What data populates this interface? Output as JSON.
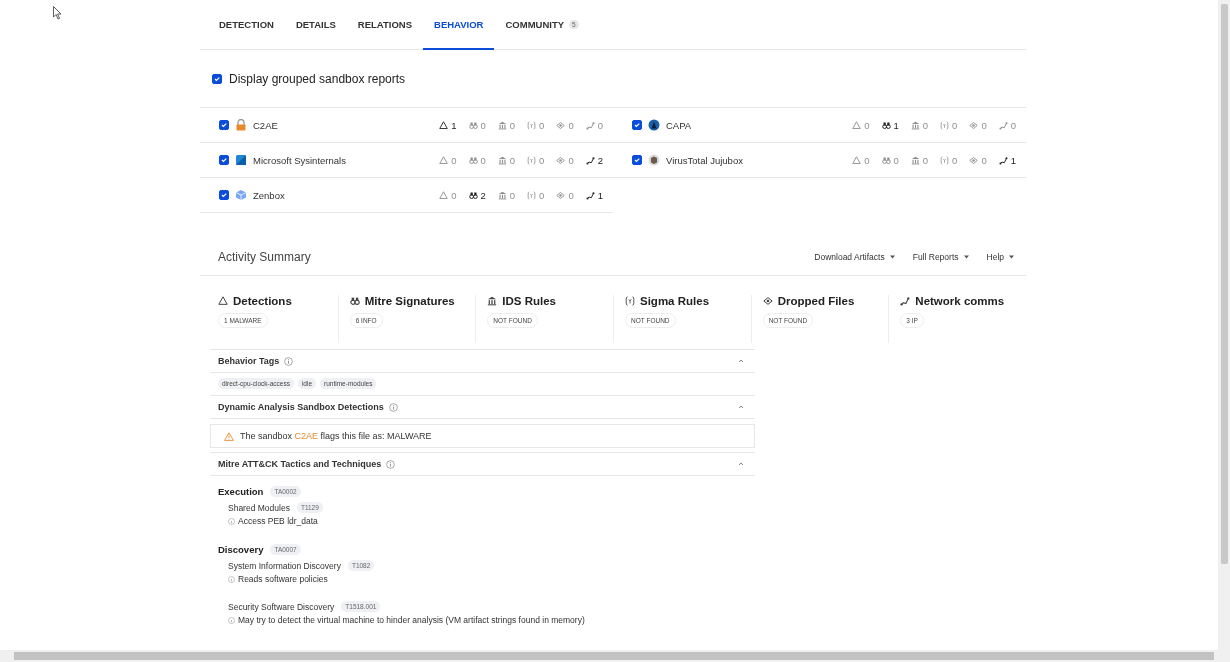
{
  "tabs": [
    {
      "label": "DETECTION",
      "selected": false
    },
    {
      "label": "DETAILS",
      "selected": false
    },
    {
      "label": "RELATIONS",
      "selected": false
    },
    {
      "label": "BEHAVIOR",
      "selected": true
    },
    {
      "label": "COMMUNITY",
      "selected": false,
      "badge": "5"
    }
  ],
  "grouped": {
    "label": "Display grouped sandbox reports",
    "checked": true
  },
  "sandboxes": [
    {
      "name": "C2AE",
      "checked": true,
      "stats": [
        {
          "value": "1",
          "highlighted": true
        },
        {
          "value": "0",
          "highlighted": false
        },
        {
          "value": "0",
          "highlighted": false
        },
        {
          "value": "0",
          "highlighted": false
        },
        {
          "value": "0",
          "highlighted": false
        },
        {
          "value": "0",
          "highlighted": false
        }
      ]
    },
    {
      "name": "CAPA",
      "checked": true,
      "stats": [
        {
          "value": "0",
          "highlighted": false
        },
        {
          "value": "1",
          "highlighted": true
        },
        {
          "value": "0",
          "highlighted": false
        },
        {
          "value": "0",
          "highlighted": false
        },
        {
          "value": "0",
          "highlighted": false
        },
        {
          "value": "0",
          "highlighted": false
        }
      ]
    },
    {
      "name": "Microsoft Sysinternals",
      "checked": true,
      "stats": [
        {
          "value": "0",
          "highlighted": false
        },
        {
          "value": "0",
          "highlighted": false
        },
        {
          "value": "0",
          "highlighted": false
        },
        {
          "value": "0",
          "highlighted": false
        },
        {
          "value": "0",
          "highlighted": false
        },
        {
          "value": "2",
          "highlighted": true
        }
      ]
    },
    {
      "name": "VirusTotal Jujubox",
      "checked": true,
      "stats": [
        {
          "value": "0",
          "highlighted": false
        },
        {
          "value": "0",
          "highlighted": false
        },
        {
          "value": "0",
          "highlighted": false
        },
        {
          "value": "0",
          "highlighted": false
        },
        {
          "value": "0",
          "highlighted": false
        },
        {
          "value": "1",
          "highlighted": true
        }
      ]
    },
    {
      "name": "Zenbox",
      "checked": true,
      "stats": [
        {
          "value": "0",
          "highlighted": false
        },
        {
          "value": "2",
          "highlighted": true
        },
        {
          "value": "0",
          "highlighted": false
        },
        {
          "value": "0",
          "highlighted": false
        },
        {
          "value": "0",
          "highlighted": false
        },
        {
          "value": "1",
          "highlighted": true
        }
      ]
    }
  ],
  "summary": {
    "title": "Activity Summary",
    "menus": [
      "Download Artifacts",
      "Full Reports",
      "Help"
    ],
    "cards": [
      {
        "title": "Detections",
        "badge": "1 MALWARE"
      },
      {
        "title": "Mitre Signatures",
        "badge": "6 INFO"
      },
      {
        "title": "IDS Rules",
        "badge": "NOT FOUND"
      },
      {
        "title": "Sigma Rules",
        "badge": "NOT FOUND"
      },
      {
        "title": "Dropped Files",
        "badge": "NOT FOUND"
      },
      {
        "title": "Network comms",
        "badge": "3 IP"
      }
    ]
  },
  "behavior_tags": {
    "title": "Behavior Tags",
    "expanded": true,
    "tags": [
      "direct-cpu-clock-access",
      "idle",
      "runtime-modules"
    ]
  },
  "sandbox_detections": {
    "title": "Dynamic Analysis Sandbox Detections",
    "expanded": true,
    "alert": {
      "prefix": "The sandbox",
      "sandbox": "C2AE",
      "suffix": "flags this file as: MALWARE"
    }
  },
  "mitre": {
    "title": "Mitre ATT&CK Tactics and Techniques",
    "expanded": true,
    "tactics": [
      {
        "name": "Execution",
        "id": "TA0002",
        "techniques": [
          {
            "name": "Shared Modules",
            "id": "T1129",
            "notes": [
              "Access PEB ldr_data"
            ]
          }
        ]
      },
      {
        "name": "Discovery",
        "id": "TA0007",
        "techniques": [
          {
            "name": "System Information Discovery",
            "id": "T1082",
            "notes": [
              "Reads software policies"
            ]
          },
          {
            "name": "Security Software Discovery",
            "id": "T1518.001",
            "notes": [
              "May try to detect the virtual machine to hinder analysis (VM artifact strings found in memory)"
            ]
          }
        ]
      }
    ]
  }
}
